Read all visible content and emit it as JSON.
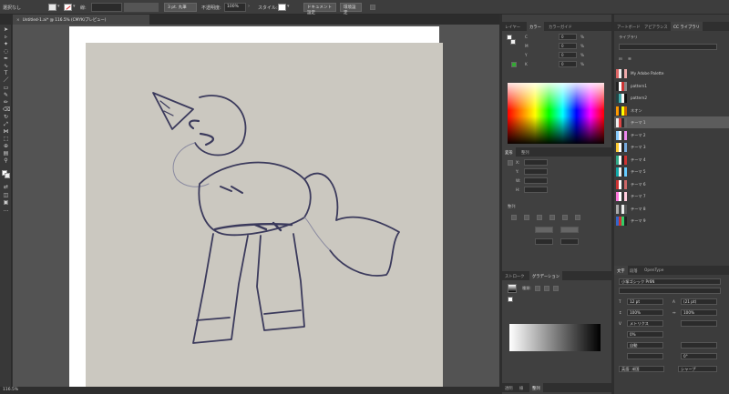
{
  "control_bar": {
    "selection_label": "選択なし",
    "stroke_label": "線:",
    "brush_label": "3 pt. 丸筆",
    "opacity_label": "不透明度:",
    "opacity_value": "100%",
    "style_label": "スタイル:",
    "doc_setup_button": "ドキュメント設定",
    "preferences_button": "環境設定"
  },
  "document_tab": {
    "title": "Untitled-1.ai* @ 116.5% (CMYK/プレビュー)"
  },
  "status": {
    "zoom": "116.5%"
  },
  "panel_col1": {
    "tabs": [
      "レイヤー",
      "カラー",
      "カラーガイド"
    ],
    "active_tab": "カラー",
    "color_sliders": [
      {
        "label": "C",
        "value": "0",
        "unit": "%"
      },
      {
        "label": "M",
        "value": "0",
        "unit": "%"
      },
      {
        "label": "Y",
        "value": "0",
        "unit": "%"
      },
      {
        "label": "K",
        "value": "0",
        "unit": "%"
      }
    ],
    "transform_section": {
      "tab1": "変形",
      "tab2": "整列",
      "x_label": "X:",
      "y_label": "Y:",
      "w_label": "W:",
      "h_label": "H:"
    },
    "appearance_section": "整列",
    "stroke_tabs": [
      "ストローク",
      "グラデーション"
    ],
    "gradient_type_label": "種類:",
    "bottom_tabs": [
      "透明",
      "線",
      "整列"
    ]
  },
  "panel_col2": {
    "tabs": [
      "アートボード",
      "アピアランス",
      "CC ライブラリ"
    ],
    "active_tab": "CC ライブラリ",
    "library_header": "ライブラリ",
    "library_items": [
      {
        "name": "My Adobe Palette",
        "colors": [
          "#d66",
          "#eee",
          "#333",
          "#eaa"
        ],
        "selected": false
      },
      {
        "name": "pattern1",
        "colors": [
          "#222",
          "#fff",
          "#c33",
          "#888"
        ],
        "selected": false
      },
      {
        "name": "pattern2",
        "colors": [
          "#244",
          "#4aa",
          "#f5f5f5",
          "#111"
        ],
        "selected": false
      },
      {
        "name": "ネオン",
        "colors": [
          "#f90",
          "#333",
          "#ff0",
          "#c60"
        ],
        "selected": false
      },
      {
        "name": "テーマ 1",
        "colors": [
          "#eee",
          "#d44",
          "#2a2a2a",
          "#666"
        ],
        "selected": true
      },
      {
        "name": "テーマ 2",
        "colors": [
          "#8cf",
          "#f5f5f5",
          "#333",
          "#e8e"
        ],
        "selected": false
      },
      {
        "name": "テーマ 3",
        "colors": [
          "#fc3",
          "#fff",
          "#222",
          "#7ad"
        ],
        "selected": false
      },
      {
        "name": "テーマ 4",
        "colors": [
          "#3a8",
          "#fff",
          "#222",
          "#c33"
        ],
        "selected": false
      },
      {
        "name": "テーマ 5",
        "colors": [
          "#1aa",
          "#eee",
          "#2a2a2a",
          "#6cf"
        ],
        "selected": false
      },
      {
        "name": "テーマ 6",
        "colors": [
          "#c33",
          "#fff",
          "#333",
          "#c66"
        ],
        "selected": false
      },
      {
        "name": "テーマ 7",
        "colors": [
          "#f7d",
          "#fff",
          "#333",
          "#fcd"
        ],
        "selected": false
      },
      {
        "name": "テーマ 8",
        "colors": [
          "#aaa",
          "#444",
          "#eee",
          "#555"
        ],
        "selected": false
      },
      {
        "name": "テーマ 9",
        "colors": [
          "#36c",
          "#c33",
          "#3c6",
          "#222"
        ],
        "selected": false
      }
    ],
    "char_tabs": [
      "文字",
      "段落",
      "OpenType"
    ],
    "font_name": "小塚ゴシック Pr6N",
    "font_size": "12 pt",
    "leading": "(21 pt)",
    "tracking": "100%",
    "vert_scale": "100%",
    "kerning": "メトリクス",
    "baseline": "0%",
    "rotation": "0°",
    "underline_label": "自動",
    "lang_label": "英語: 米国",
    "sharp_label": "シャープ"
  },
  "colors": {
    "app_bg": "#323232",
    "panel_bg": "#404040",
    "canvas_bg": "#535353",
    "paper_photo": "#cbc8c0",
    "ink": "#3b3a5c"
  },
  "icons": [
    "selection-tool-icon",
    "direct-selection-icon",
    "pen-icon",
    "type-icon",
    "line-icon",
    "rectangle-icon",
    "paintbrush-icon",
    "pencil-icon",
    "eraser-icon",
    "rotate-icon",
    "scale-icon",
    "width-icon",
    "shape-builder-icon",
    "gradient-icon",
    "eyedropper-icon",
    "blend-icon",
    "symbol-icon",
    "graph-icon",
    "artboard-icon",
    "slice-icon",
    "hand-icon",
    "zoom-icon"
  ]
}
